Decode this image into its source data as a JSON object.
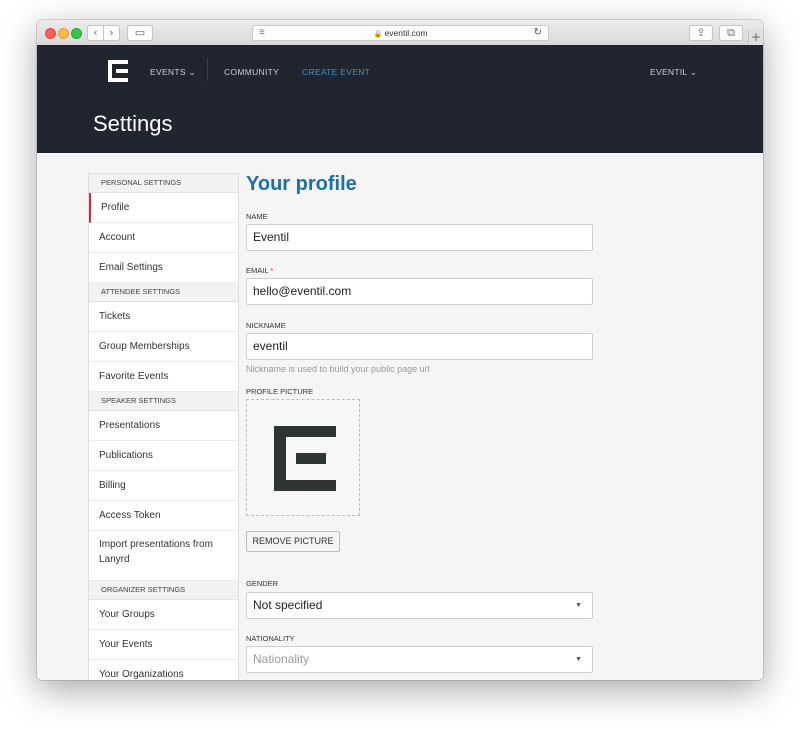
{
  "browser": {
    "url": "eventil.com",
    "back_icon": "‹",
    "forward_icon": "›",
    "sidebar_icon": "▭",
    "reader_icon": "≡",
    "lock_icon": "🔒",
    "reload_icon": "↻",
    "share_icon": "⇪",
    "tabs_icon": "⧉",
    "newtab_icon": "+"
  },
  "nav": {
    "events": "EVENTS ⌄",
    "community": "COMMUNITY",
    "create_event": "CREATE EVENT",
    "user": "EVENTIL ⌄"
  },
  "page_title": "Settings",
  "sidebar": {
    "sections": [
      {
        "header": "PERSONAL SETTINGS",
        "items": [
          "Profile",
          "Account",
          "Email Settings"
        ]
      },
      {
        "header": "ATTENDEE SETTINGS",
        "items": [
          "Tickets",
          "Group Memberships",
          "Favorite Events"
        ]
      },
      {
        "header": "SPEAKER SETTINGS",
        "items": [
          "Presentations",
          "Publications",
          "Billing",
          "Access Token",
          "Import presentations from Lanyrd"
        ]
      },
      {
        "header": "ORGANIZER SETTINGS",
        "items": [
          "Your Groups",
          "Your Events",
          "Your Organizations"
        ]
      }
    ]
  },
  "profile": {
    "heading": "Your profile",
    "name_label": "NAME",
    "name_value": "Eventil",
    "email_label": "EMAIL",
    "required_mark": "*",
    "email_value": "hello@eventil.com",
    "nickname_label": "NICKNAME",
    "nickname_value": "eventil",
    "nickname_hint": "Nickname is used to build your public page url",
    "picture_label": "PROFILE PICTURE",
    "remove_picture": "REMOVE PICTURE",
    "gender_label": "GENDER",
    "gender_value": "Not specified",
    "nationality_label": "NATIONALITY",
    "nationality_placeholder": "Nationality",
    "caret_icon": "▼"
  },
  "colors": {
    "nav_bg": "#212530",
    "accent_blue": "#1d6faa",
    "link_blue": "#3b8fd0",
    "active_red": "#e0233a"
  }
}
